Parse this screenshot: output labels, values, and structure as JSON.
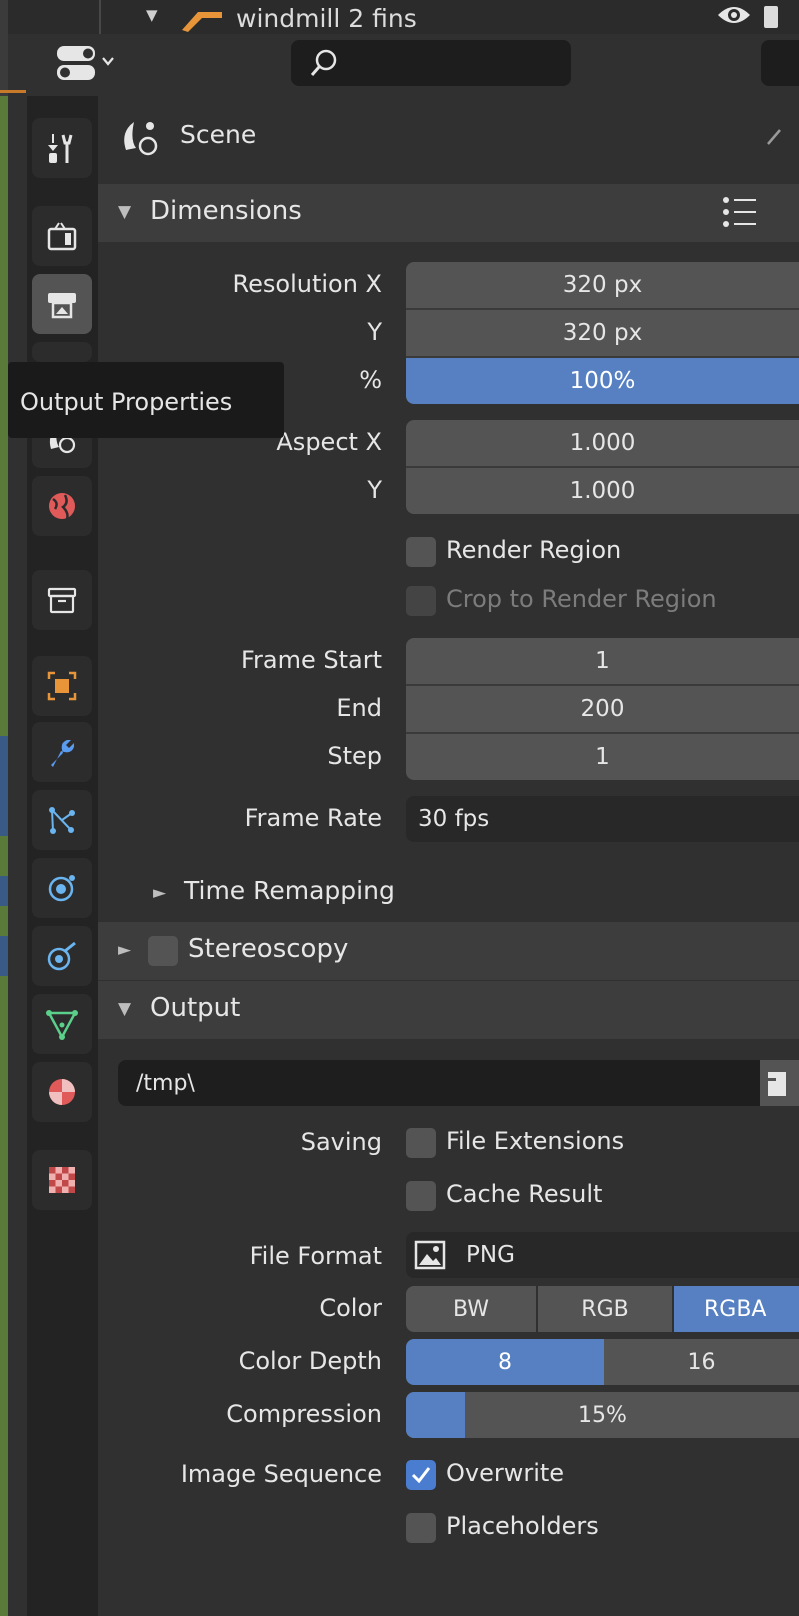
{
  "outliner": {
    "object_name": "windmill 2 fins",
    "expand_arrow": "▼"
  },
  "search": {
    "placeholder": ""
  },
  "tooltip": {
    "text": "Output Properties"
  },
  "scene": {
    "label": "Scene"
  },
  "sections": {
    "dimensions": "Dimensions",
    "time_remapping": "Time Remapping",
    "stereoscopy": "Stereoscopy",
    "output": "Output"
  },
  "dimensions": {
    "resolution_x_label": "Resolution X",
    "resolution_x": "320 px",
    "resolution_y_label": "Y",
    "resolution_y": "320 px",
    "percent_label": "%",
    "percent": "100%",
    "aspect_x_label": "Aspect X",
    "aspect_x": "1.000",
    "aspect_y_label": "Y",
    "aspect_y": "1.000",
    "render_region": "Render Region",
    "crop_region": "Crop to Render Region",
    "frame_start_label": "Frame Start",
    "frame_start": "1",
    "end_label": "End",
    "end": "200",
    "step_label": "Step",
    "step": "1",
    "frame_rate_label": "Frame Rate",
    "frame_rate": "30 fps"
  },
  "output": {
    "path": "/tmp\\",
    "saving_label": "Saving",
    "file_extensions": "File Extensions",
    "cache_result": "Cache Result",
    "file_format_label": "File Format",
    "file_format": "PNG",
    "color_label": "Color",
    "color_options": [
      "BW",
      "RGB",
      "RGBA"
    ],
    "color_selected": "RGBA",
    "color_depth_label": "Color Depth",
    "color_depth_options": [
      "8",
      "16"
    ],
    "color_depth_selected": "8",
    "compression_label": "Compression",
    "compression": "15%",
    "compression_value": 0.15,
    "image_sequence_label": "Image Sequence",
    "overwrite": "Overwrite",
    "overwrite_checked": true,
    "placeholders": "Placeholders"
  },
  "colors": {
    "accent_blue": "#5680c2",
    "panel_bg": "#303030",
    "field_bg": "#545454",
    "section_bg": "#3d3d3d"
  },
  "tabs": [
    "tool-icon",
    "render-icon",
    "output-icon",
    "view-layer-icon",
    "scene-icon",
    "world-icon",
    "collection-icon",
    "object-icon",
    "modifier-icon",
    "particles-icon",
    "physics-icon",
    "constraints-icon",
    "data-icon",
    "material-icon",
    "texture-icon"
  ]
}
